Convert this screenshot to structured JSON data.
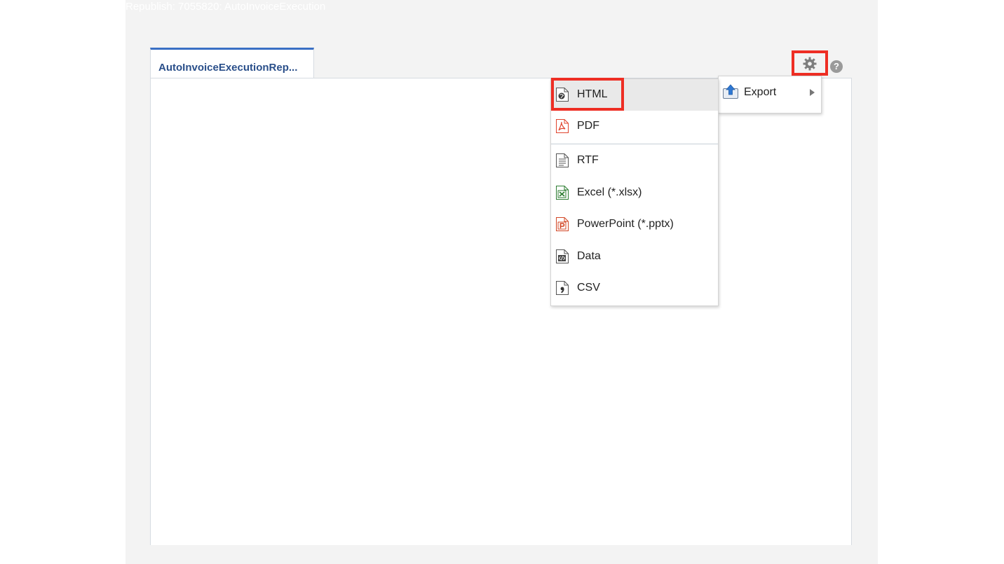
{
  "window": {
    "title": "Republish: 7055820: AutoInvoiceExecution"
  },
  "tabs": [
    {
      "label": "AutoInvoiceExecutionRep..."
    }
  ],
  "toolbar": {
    "gear_icon": "gear-icon",
    "help_icon": "help-icon",
    "help_glyph": "?"
  },
  "menu": {
    "items": [
      {
        "label": "Export",
        "icon": "export-icon"
      }
    ]
  },
  "export_submenu": {
    "items": [
      {
        "label": "HTML",
        "icon": "html-file-icon"
      },
      {
        "label": "PDF",
        "icon": "pdf-file-icon"
      },
      {
        "label": "RTF",
        "icon": "rtf-file-icon"
      },
      {
        "label": "Excel (*.xlsx)",
        "icon": "excel-file-icon"
      },
      {
        "label": "PowerPoint (*.pptx)",
        "icon": "powerpoint-file-icon"
      },
      {
        "label": "Data",
        "icon": "data-file-icon"
      },
      {
        "label": "CSV",
        "icon": "csv-file-icon"
      }
    ]
  },
  "colors": {
    "highlight_border": "#ee2e24",
    "tab_accent": "#3a6fc4",
    "tab_text": "#2a4f8a",
    "page_background": "#f3f3f3"
  }
}
